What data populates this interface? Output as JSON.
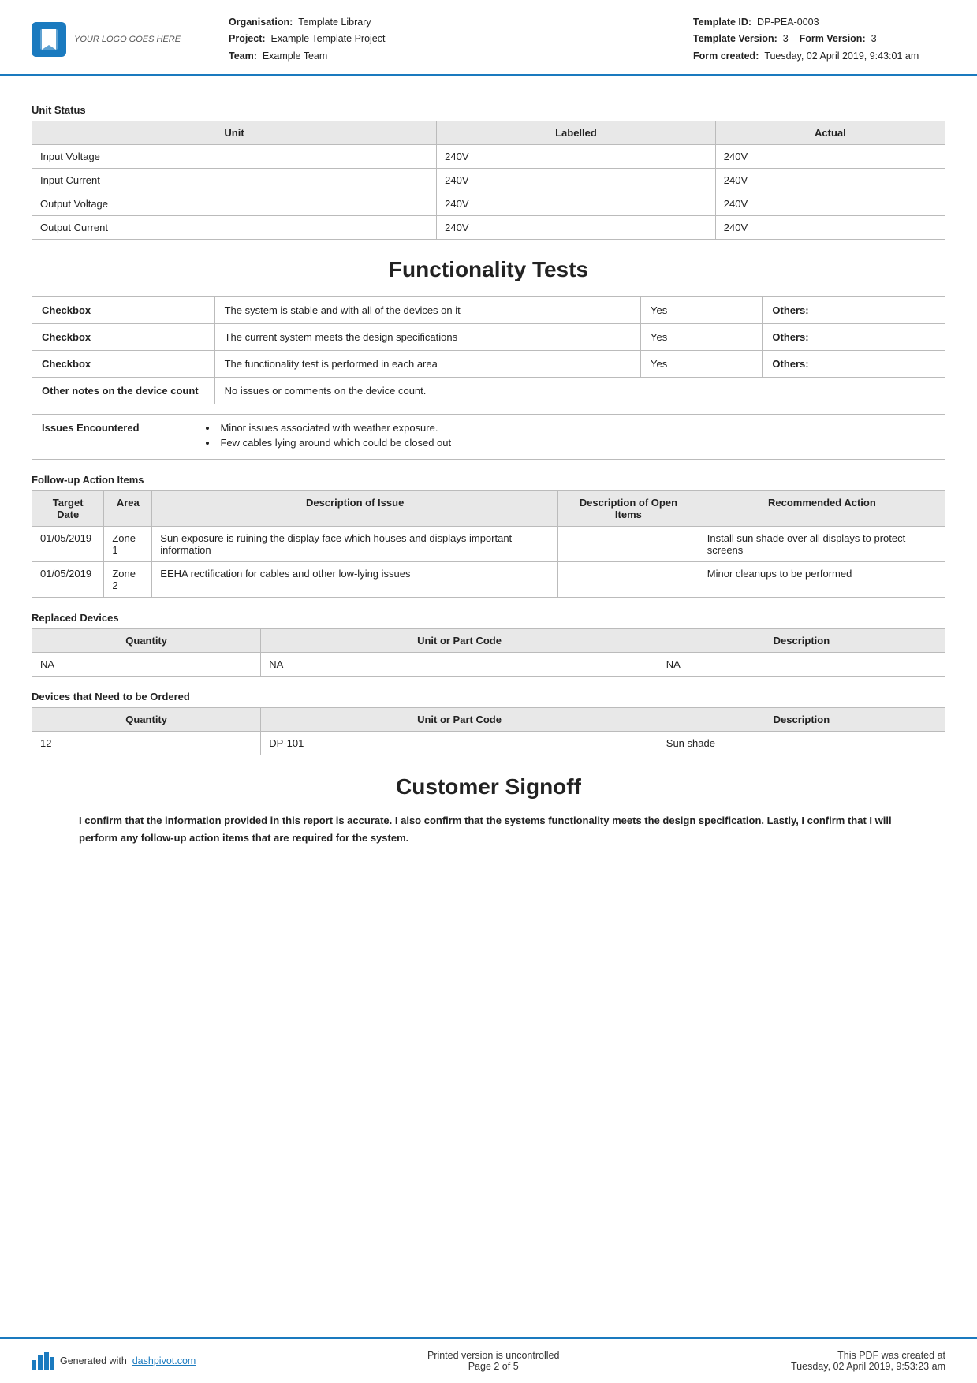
{
  "header": {
    "logo_text": "YOUR LOGO GOES HERE",
    "org_label": "Organisation:",
    "org_value": "Template Library",
    "project_label": "Project:",
    "project_value": "Example Template Project",
    "team_label": "Team:",
    "team_value": "Example Team",
    "template_id_label": "Template ID:",
    "template_id_value": "DP-PEA-0003",
    "template_version_label": "Template Version:",
    "template_version_value": "3",
    "form_version_label": "Form Version:",
    "form_version_value": "3",
    "form_created_label": "Form created:",
    "form_created_value": "Tuesday, 02 April 2019, 9:43:01 am"
  },
  "unit_status": {
    "section_label": "Unit Status",
    "columns": [
      "Unit",
      "Labelled",
      "Actual"
    ],
    "rows": [
      [
        "Input Voltage",
        "240V",
        "240V"
      ],
      [
        "Input Current",
        "240V",
        "240V"
      ],
      [
        "Output Voltage",
        "240V",
        "240V"
      ],
      [
        "Output Current",
        "240V",
        "240V"
      ]
    ]
  },
  "functionality_tests": {
    "heading": "Functionality Tests",
    "rows": [
      {
        "label": "Checkbox",
        "description": "The system is stable and with all of the devices on it",
        "value": "Yes",
        "others_label": "Others:"
      },
      {
        "label": "Checkbox",
        "description": "The current system meets the design specifications",
        "value": "Yes",
        "others_label": "Others:"
      },
      {
        "label": "Checkbox",
        "description": "The functionality test is performed in each area",
        "value": "Yes",
        "others_label": "Others:"
      },
      {
        "label": "Other notes on the device count",
        "description": "No issues or comments on the device count.",
        "value": "",
        "others_label": ""
      }
    ],
    "issues_label": "Issues Encountered",
    "issues": [
      "Minor issues associated with weather exposure.",
      "Few cables lying around which could be closed out"
    ]
  },
  "followup": {
    "section_label": "Follow-up Action Items",
    "columns": [
      "Target Date",
      "Area",
      "Description of Issue",
      "Description of Open Items",
      "Recommended Action"
    ],
    "rows": [
      {
        "target_date": "01/05/2019",
        "area": "Zone 1",
        "description": "Sun exposure is ruining the display face which houses and displays important information",
        "open_items": "",
        "recommended": "Install sun shade over all displays to protect screens"
      },
      {
        "target_date": "01/05/2019",
        "area": "Zone 2",
        "description": "EEHA rectification for cables and other low-lying issues",
        "open_items": "",
        "recommended": "Minor cleanups to be performed"
      }
    ]
  },
  "replaced_devices": {
    "section_label": "Replaced Devices",
    "columns": [
      "Quantity",
      "Unit or Part Code",
      "Description"
    ],
    "rows": [
      [
        "NA",
        "NA",
        "NA"
      ]
    ]
  },
  "devices_to_order": {
    "section_label": "Devices that Need to be Ordered",
    "columns": [
      "Quantity",
      "Unit or Part Code",
      "Description"
    ],
    "rows": [
      [
        "12",
        "DP-101",
        "Sun shade"
      ]
    ]
  },
  "customer_signoff": {
    "heading": "Customer Signoff",
    "text": "I confirm that the information provided in this report is accurate. I also confirm that the systems functionality meets the design specification. Lastly, I confirm that I will perform any follow-up action items that are required for the system."
  },
  "footer": {
    "generated_text": "Generated with",
    "link_text": "dashpivot.com",
    "center_line1": "Printed version is uncontrolled",
    "center_line2": "Page 2 of 5",
    "right_line1": "This PDF was created at",
    "right_line2": "Tuesday, 02 April 2019, 9:53:23 am"
  }
}
